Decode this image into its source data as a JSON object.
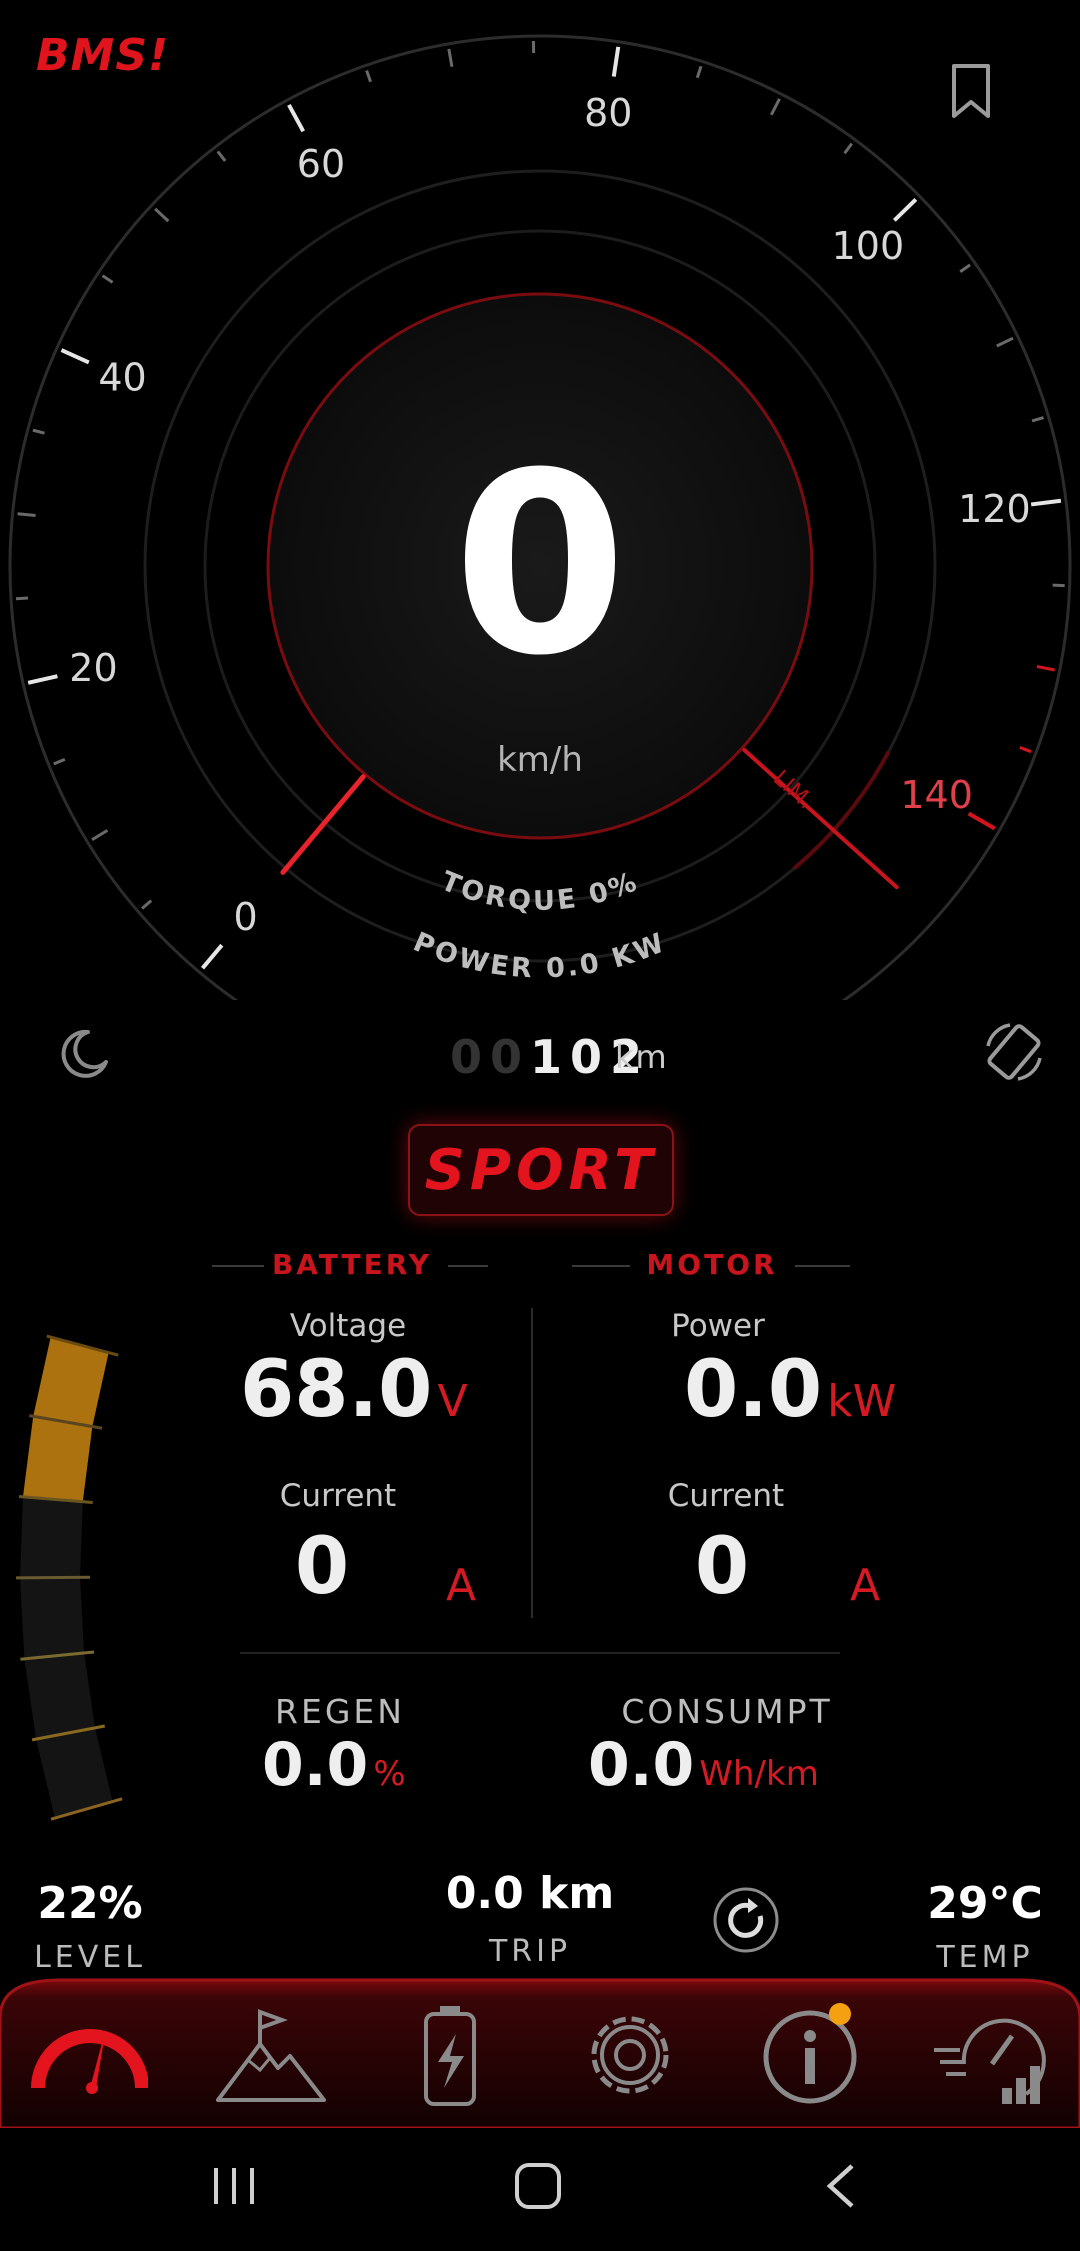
{
  "app": {
    "brand": "BMS!"
  },
  "speedometer": {
    "speed": "0",
    "unit": "km/h",
    "tick_labels": [
      "0",
      "20",
      "40",
      "60",
      "80",
      "100",
      "120",
      "140"
    ],
    "max": 140,
    "limit_label": "LIM.",
    "torque": "TORQUE 0%",
    "power": "POWER 0.0 KW"
  },
  "odometer": {
    "dim_digits": "00",
    "lit_digits": "102",
    "unit": "km"
  },
  "mode": "SPORT",
  "battery": {
    "title": "BATTERY",
    "voltage_label": "Voltage",
    "voltage": "68.0",
    "voltage_unit": "V",
    "current_label": "Current",
    "current": "0",
    "current_unit": "A"
  },
  "motor": {
    "title": "MOTOR",
    "power_label": "Power",
    "power": "0.0",
    "power_unit": "kW",
    "current_label": "Current",
    "current": "0",
    "current_unit": "A"
  },
  "regen": {
    "label": "REGEN",
    "value": "0.0",
    "unit": "%"
  },
  "consumpt": {
    "label": "CONSUMPT",
    "value": "0.0",
    "unit": "Wh/km"
  },
  "level": {
    "value": "22%",
    "label": "LEVEL",
    "fraction": 0.22
  },
  "trip": {
    "value": "0.0 km",
    "label": "TRIP"
  },
  "temp": {
    "value": "29°C",
    "label": "TEMP",
    "fraction": 0.2
  },
  "nav": {
    "items": [
      {
        "icon": "speedometer-icon",
        "active": true
      },
      {
        "icon": "mountain-flag-icon"
      },
      {
        "icon": "battery-charge-icon"
      },
      {
        "icon": "settings-gear-icon"
      },
      {
        "icon": "info-icon",
        "badge": true
      },
      {
        "icon": "speed-stats-icon"
      }
    ]
  },
  "colors": {
    "accent": "#e0141c",
    "level_bar": "#c98612",
    "temp_bar": "#4c9a4c",
    "badge": "#f5a010"
  }
}
